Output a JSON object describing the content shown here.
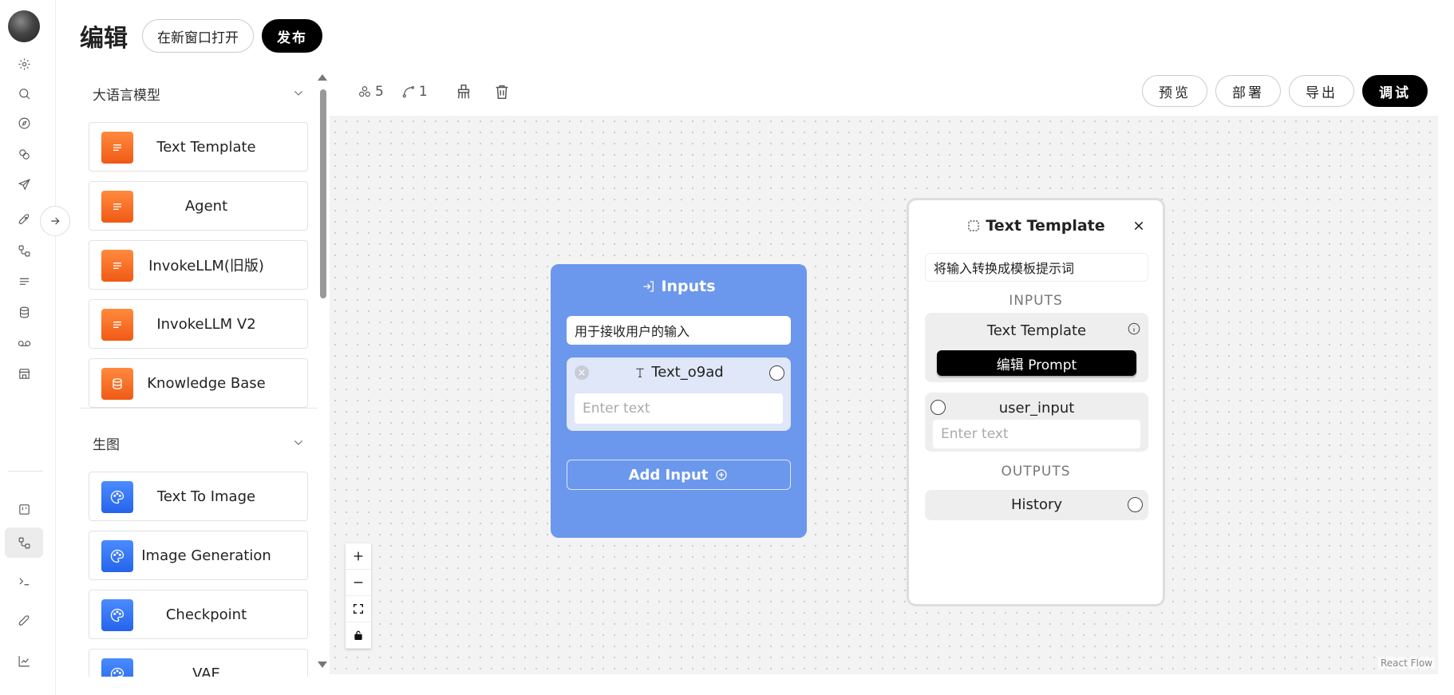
{
  "header": {
    "title": "编辑",
    "open_new_window": "在新窗口打开",
    "publish": "发布"
  },
  "panel": {
    "categories": [
      {
        "label": "大语言模型"
      },
      {
        "label": "生图"
      }
    ],
    "llm_items": [
      {
        "label": "Text Template",
        "icon": "text-lines-icon"
      },
      {
        "label": "Agent",
        "icon": "text-lines-icon"
      },
      {
        "label": "InvokeLLM(旧版)",
        "icon": "text-lines-icon"
      },
      {
        "label": "InvokeLLM V2",
        "icon": "text-lines-icon"
      },
      {
        "label": "Knowledge Base",
        "icon": "database-icon"
      }
    ],
    "image_items": [
      {
        "label": "Text To Image",
        "icon": "palette-icon"
      },
      {
        "label": "Image Generation",
        "icon": "palette-icon"
      },
      {
        "label": "Checkpoint",
        "icon": "palette-icon"
      },
      {
        "label": "VAE",
        "icon": "palette-icon"
      }
    ]
  },
  "toolbar": {
    "node_count": "5",
    "edge_count": "1"
  },
  "actions": {
    "preview": "预览",
    "deploy": "部署",
    "export": "导出",
    "debug": "调试"
  },
  "canvas": {
    "attribution": "React Flow"
  },
  "inputs_node": {
    "title": "Inputs",
    "description": "用于接收用户的输入",
    "field_name": "Text_o9ad",
    "field_placeholder": "Enter text",
    "add_input": "Add Input"
  },
  "template_node": {
    "title": "Text Template",
    "description": "将输入转换成模板提示词",
    "inputs_label": "INPUTS",
    "template_label": "Text Template",
    "edit_prompt": "编辑 Prompt",
    "user_input_label": "user_input",
    "user_input_placeholder": "Enter text",
    "outputs_label": "OUTPUTS",
    "history_label": "History"
  },
  "colors": {
    "inputs_node_bg": "#6b97ec",
    "orange_icon": "#f05a16",
    "blue_icon": "#2563eb",
    "primary_button": "#000000"
  }
}
